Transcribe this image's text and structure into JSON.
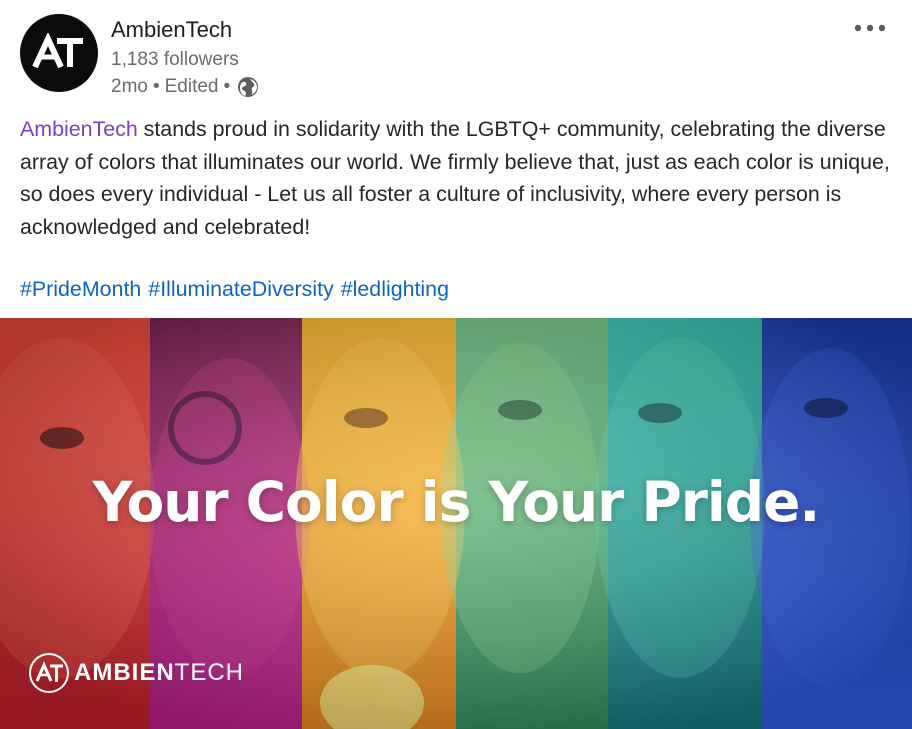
{
  "header": {
    "company_name": "AmbienTech",
    "followers": "1,183 followers",
    "time": "2mo",
    "edited": "Edited",
    "visibility_icon": "globe-icon",
    "more_icon": "ellipsis-icon"
  },
  "post": {
    "mention": "AmbienTech",
    "text_after_mention": " stands proud in solidarity with the LGBTQ+ community, celebrating the diverse array of colors that illuminates our world. We firmly believe that, just as each color is unique, so does every individual - Let us all foster a culture of inclusivity, where every person is acknowledged and celebrated!",
    "hashtags": [
      "#PrideMonth",
      "#IlluminateDiversity",
      "#ledlighting"
    ]
  },
  "image": {
    "headline": "Your Color is Your Pride.",
    "brand_bold": "AMBIEN",
    "brand_light": "TECH",
    "panel_colors": [
      "#e8303a",
      "#b0287a",
      "#f29b22",
      "#3aa06e",
      "#1f9ea0",
      "#2a4fd8"
    ]
  },
  "colors": {
    "mention": "#7a3fc9",
    "hashtag": "#0a66c2",
    "secondary_text": "#6b6b6b"
  }
}
